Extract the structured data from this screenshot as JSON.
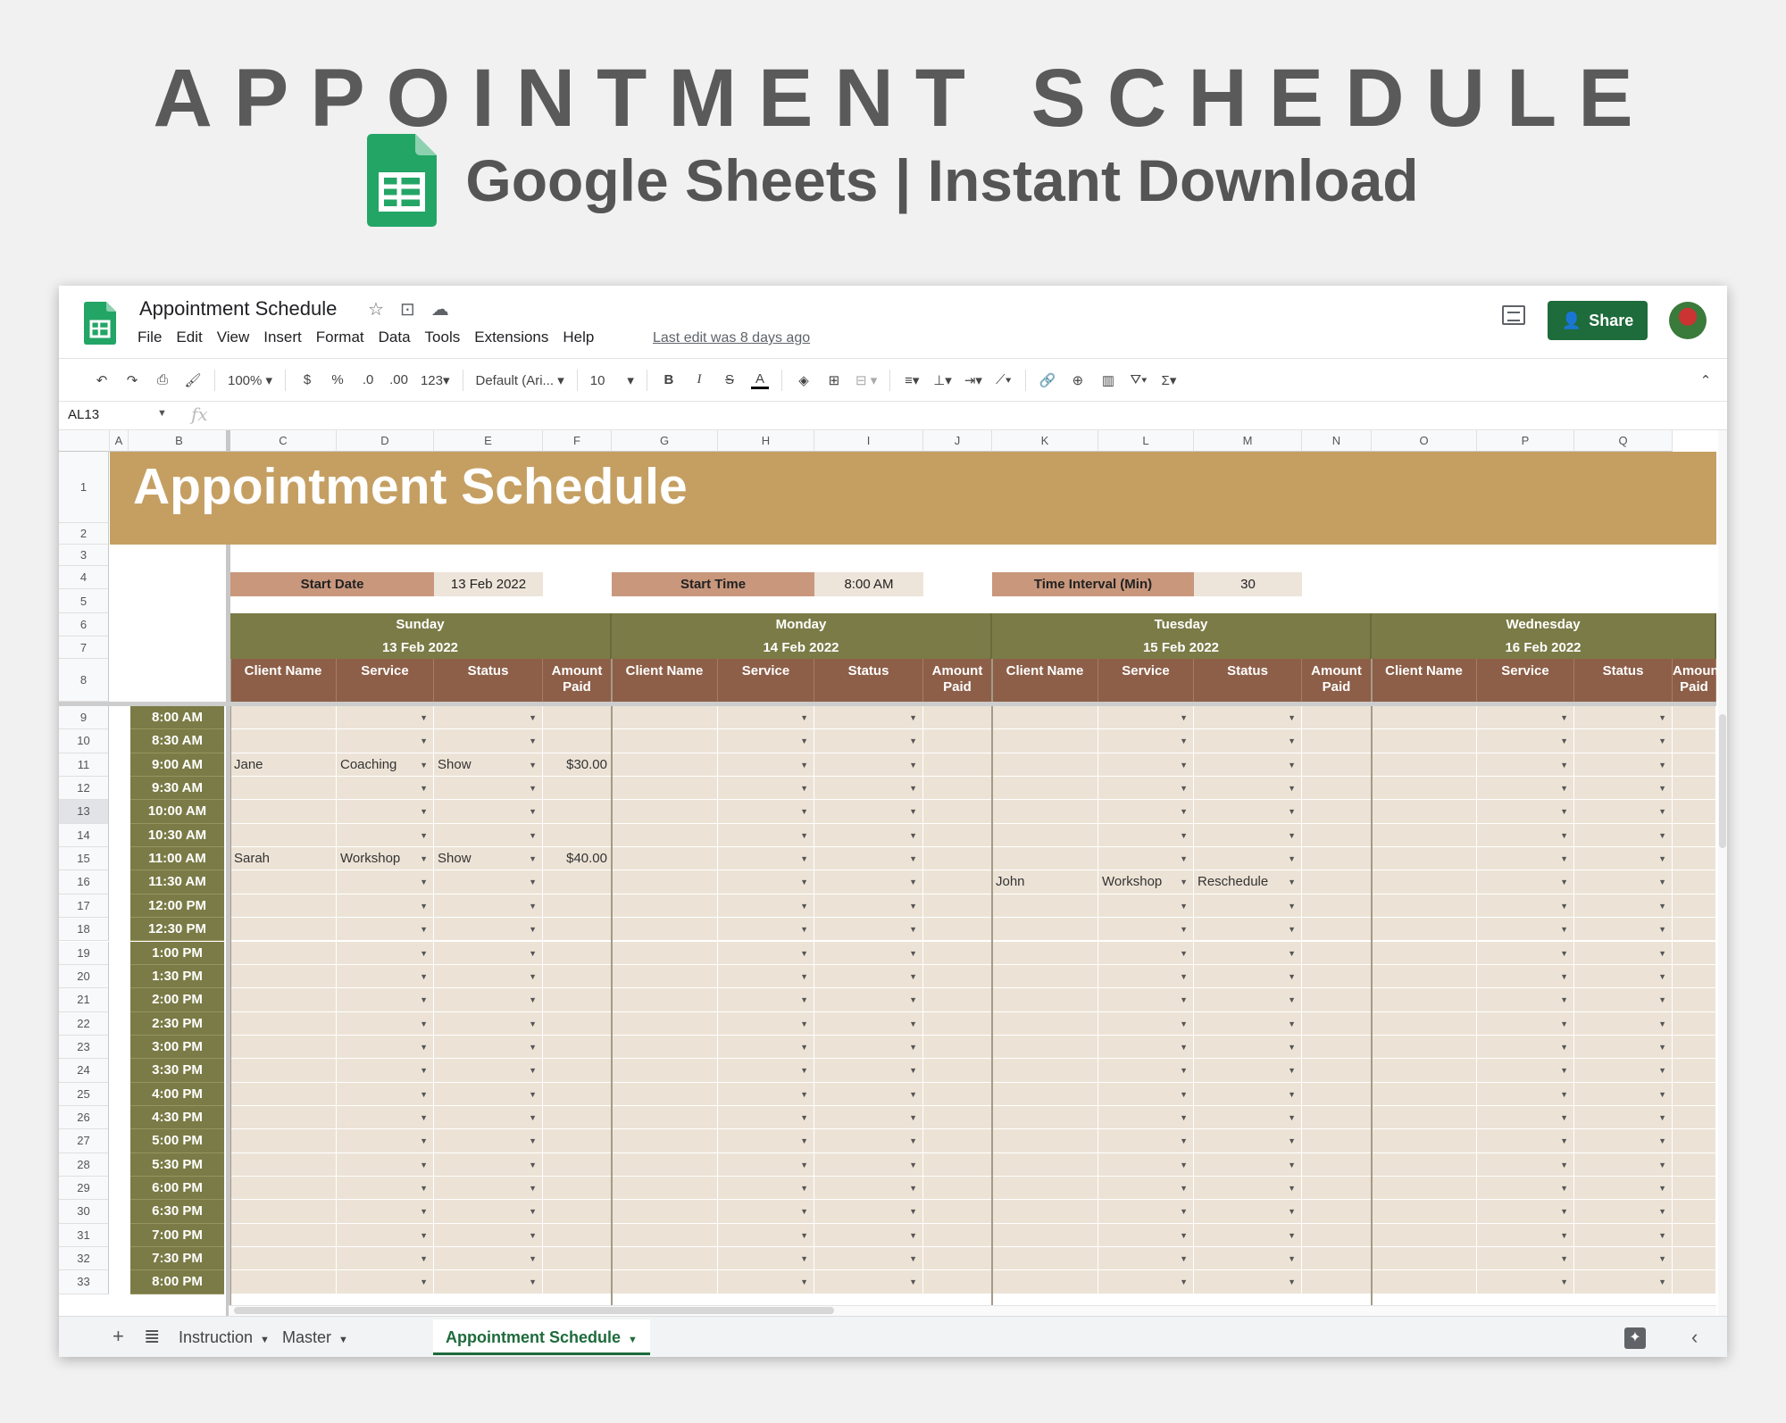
{
  "hero": {
    "title": "APPOINTMENT SCHEDULE",
    "subtitle": "Google Sheets | Instant Download"
  },
  "titlebar": {
    "doc_title": "Appointment Schedule",
    "menus": [
      "File",
      "Edit",
      "View",
      "Insert",
      "Format",
      "Data",
      "Tools",
      "Extensions",
      "Help"
    ],
    "last_edit": "Last edit was 8 days ago",
    "share_label": "Share"
  },
  "toolbar": {
    "zoom": "100%",
    "currency": "$",
    "percent": "%",
    "decimal_decrease": ".0",
    "decimal_increase": ".00",
    "number_format": "123",
    "font": "Default (Ari...",
    "font_size": "10"
  },
  "formula_bar": {
    "name_box": "AL13",
    "fx": "fx"
  },
  "columns": [
    "A",
    "B",
    "C",
    "D",
    "E",
    "F",
    "G",
    "H",
    "I",
    "J",
    "K",
    "L",
    "M",
    "N",
    "O",
    "P",
    "Q"
  ],
  "sheet": {
    "banner_title": "Appointment Schedule",
    "config": {
      "start_date_label": "Start Date",
      "start_date": "13 Feb 2022",
      "start_time_label": "Start Time",
      "start_time": "8:00 AM",
      "interval_label": "Time Interval (Min)",
      "interval": "30"
    },
    "days": [
      {
        "name": "Sunday",
        "date": "13 Feb 2022"
      },
      {
        "name": "Monday",
        "date": "14 Feb 2022"
      },
      {
        "name": "Tuesday",
        "date": "15 Feb 2022"
      },
      {
        "name": "Wednesday",
        "date": "16 Feb 2022"
      }
    ],
    "sub_headers": [
      "Client Name",
      "Service",
      "Status",
      "Amount Paid"
    ],
    "times": [
      "8:00 AM",
      "8:30 AM",
      "9:00 AM",
      "9:30 AM",
      "10:00 AM",
      "10:30 AM",
      "11:00 AM",
      "11:30 AM",
      "12:00 PM",
      "12:30 PM",
      "1:00 PM",
      "1:30 PM",
      "2:00 PM",
      "2:30 PM",
      "3:00 PM",
      "3:30 PM",
      "4:00 PM",
      "4:30 PM",
      "5:00 PM",
      "5:30 PM",
      "6:00 PM",
      "6:30 PM",
      "7:00 PM",
      "7:30 PM",
      "8:00 PM"
    ],
    "appointments": [
      {
        "time": "9:00 AM",
        "day": "Sunday",
        "client": "Jane",
        "service": "Coaching",
        "status": "Show",
        "amount": "$30.00"
      },
      {
        "time": "11:00 AM",
        "day": "Sunday",
        "client": "Sarah",
        "service": "Workshop",
        "status": "Show",
        "amount": "$40.00"
      },
      {
        "time": "11:30 AM",
        "day": "Tuesday",
        "client": "John",
        "service": "Workshop",
        "status": "Reschedule",
        "amount": ""
      }
    ]
  },
  "tabs": [
    {
      "label": "Instruction",
      "active": false
    },
    {
      "label": "Master",
      "active": false
    },
    {
      "label": "Appointment Schedule",
      "active": true
    }
  ],
  "colors": {
    "banner": "#c59f62",
    "day_header": "#7b7b47",
    "sub_header": "#8d5f48",
    "cell_fill": "#ece3d6",
    "config_label": "#c9977c",
    "share_green": "#1e6b3c"
  }
}
